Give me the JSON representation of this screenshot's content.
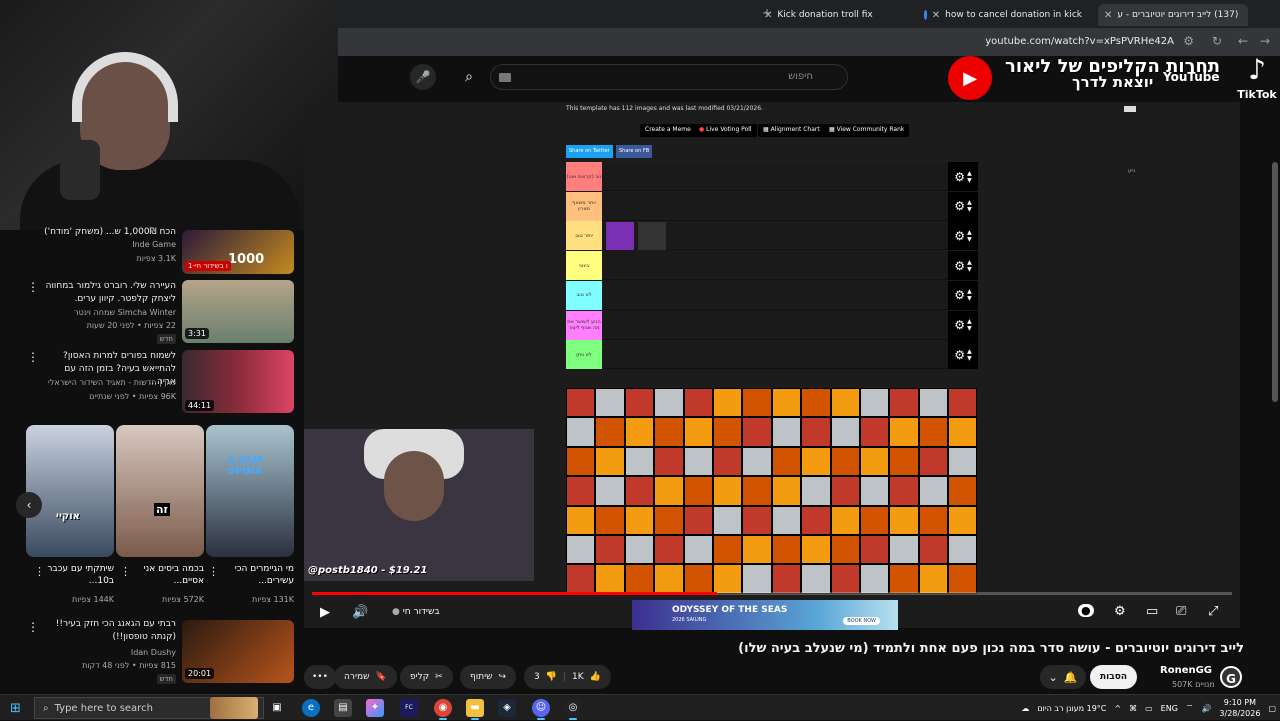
{
  "browser": {
    "tabs": [
      {
        "label": "(137) לייב דירוגים יוטיוברים - ע",
        "active": true
      },
      {
        "label": "how to cancel donation in kick",
        "active": false
      },
      {
        "label": "Kick donation troll fix",
        "active": false
      }
    ],
    "new_tab": "+",
    "url": "youtube.com/watch?v=xPsPVRHe42A"
  },
  "youtube": {
    "search_placeholder": "חיפוש",
    "video_title": "לייב דירוגים יוטיוברים - עושה סדר במה נכון פעם אחת ולתמיד (מי שנעלב בעיה שלו)",
    "channel": {
      "name": "RonenGG",
      "subs": "507K מנויים",
      "avatar_letter": "G"
    },
    "subscribe_label": "הסבות",
    "actions": {
      "likes": "1K",
      "dislikes": "3",
      "share": "שיתוף",
      "clip": "קליפ",
      "save": "שמירה",
      "more": "•••"
    },
    "player": {
      "live_label": "בשידור חי",
      "progress": 0.44
    },
    "tier_template": {
      "info": "This template has 112 images and was last modified 03/21/2026.",
      "buttons": [
        "Create a Meme",
        "Live Voting Poll",
        "Alignment Chart",
        "View Community Rank"
      ],
      "share_buttons": [
        "Share on Twitter",
        "Share on FB"
      ],
      "tiers": [
        {
          "label": "נוב (קרוווס אוט)",
          "color": "#ff7f7f"
        },
        {
          "label": "יותר משאף מצרין",
          "color": "#ffbf7f"
        },
        {
          "label": "יותר טוב",
          "color": "#ffdf7f"
        },
        {
          "label": "בינוני",
          "color": "#ffff7f"
        },
        {
          "label": "לא טוב",
          "color": "#7fffff"
        },
        {
          "label": "הגיע לשושר את מה שגוף ליצור",
          "color": "#ff7fff"
        },
        {
          "label": "לא ניתן",
          "color": "#7fff7f"
        }
      ],
      "side_label": "נייע"
    },
    "alert": "@postb1840 - $19.21",
    "ad": {
      "title": "ODYSSEY OF THE SEAS",
      "sub": "2026 SAILING",
      "book": "BOOK NOW"
    }
  },
  "overlay": {
    "line1": "תחרות הקליפים של ליאור",
    "line2": "יוצאת לדרך",
    "youtube_word": "YouTube",
    "tiktok": "TikTok"
  },
  "recommendations": [
    {
      "title": "הכח 1,000₪ ש... (משחק 'מודח')",
      "channel": "Inde Game",
      "meta": "3.1K צפיות",
      "badge": "1-ו בשידור חי",
      "thumb": "#c58b1f"
    },
    {
      "title": "העיירה שלי. רוברט גילמור במחווה ליצחק קלפטר. קיוון ערים.",
      "channel": "Simcha Winter שמחה וינטר",
      "meta": "22 צפיות • לפני 20 שעות",
      "tag": "חדש",
      "duration": "3:31",
      "thumb": "#6a7f6e"
    },
    {
      "title": "לשמוח בפורים למרות האסון? להתייאש בעיה? בזמן הזה עם אריה...",
      "channel": "כאן | חדשות - תאגיד השידור הישראלי",
      "meta": "96K צפיות • לפני שנתיים",
      "duration": "44:11",
      "thumb": "#8a2b3a"
    },
    {
      "title": "רבתי עם הגאנג הכי חזק בעיר!! (קנתה טופסון!!)",
      "channel": "Idan Dushy",
      "meta": "815 צפיות • לפני 48 דקות",
      "tag": "חדש",
      "duration": "20:01",
      "thumb": "#b8541c"
    }
  ],
  "shorts": [
    {
      "title": "מי הגיימרים הכי עשירים...",
      "views": "131K צפיות",
      "overlay": "2.85M SPINX",
      "thumb": "#c4d4da"
    },
    {
      "title": "בכמה ביסים אני אסיים...",
      "views": "572K צפיות",
      "overlay": "זה",
      "thumb": "#7a5a4a"
    },
    {
      "title": "שיתקתי עם עכבר ב10...",
      "views": "144K צפיות",
      "overlay": "אוקיי",
      "thumb": "#3a4a5e"
    }
  ],
  "taskbar": {
    "search_placeholder": "Type here to search",
    "weather": "19°C מעונן רב היום",
    "lang": "ENG",
    "time": "9:10 PM",
    "date": "3/28/2026"
  }
}
